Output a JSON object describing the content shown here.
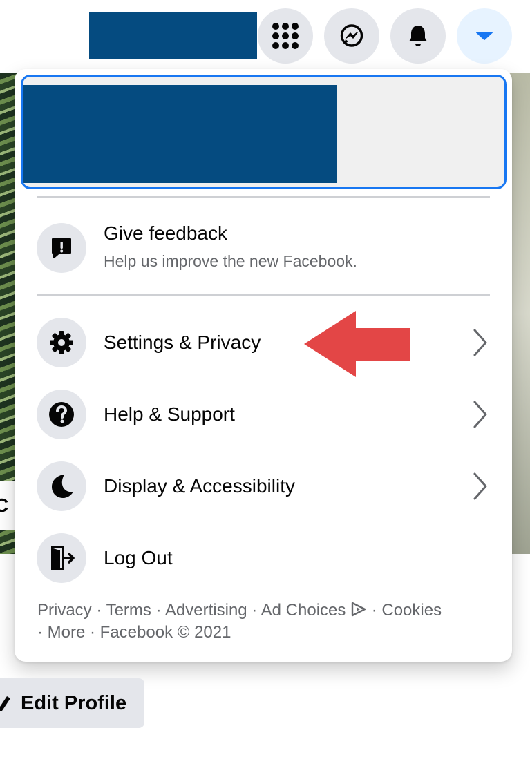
{
  "colors": {
    "accent": "#1877f2",
    "redaction": "#054b80",
    "annotation_arrow": "#e34646",
    "secondary_text": "#65676b"
  },
  "topbar": {
    "icons": [
      "menu-grid-icon",
      "messenger-icon",
      "notifications-bell-icon",
      "account-caret-icon"
    ]
  },
  "background": {
    "name_fragment": "C"
  },
  "menu": {
    "items": [
      {
        "label": "Give feedback",
        "sublabel": "Help us improve the new Facebook.",
        "icon": "feedback-icon"
      },
      {
        "label": "Settings & Privacy",
        "icon": "gear-icon",
        "has_submenu": true
      },
      {
        "label": "Help & Support",
        "icon": "question-icon",
        "has_submenu": true
      },
      {
        "label": "Display & Accessibility",
        "icon": "moon-icon",
        "has_submenu": true
      },
      {
        "label": "Log Out",
        "icon": "logout-icon"
      }
    ],
    "footer": {
      "line1": "Privacy · Terms · Advertising · Ad Choices",
      "line1_end": " · Cookies",
      "line2": "· More · Facebook © 2021"
    }
  },
  "edit_profile": {
    "label": "Edit Profile"
  }
}
